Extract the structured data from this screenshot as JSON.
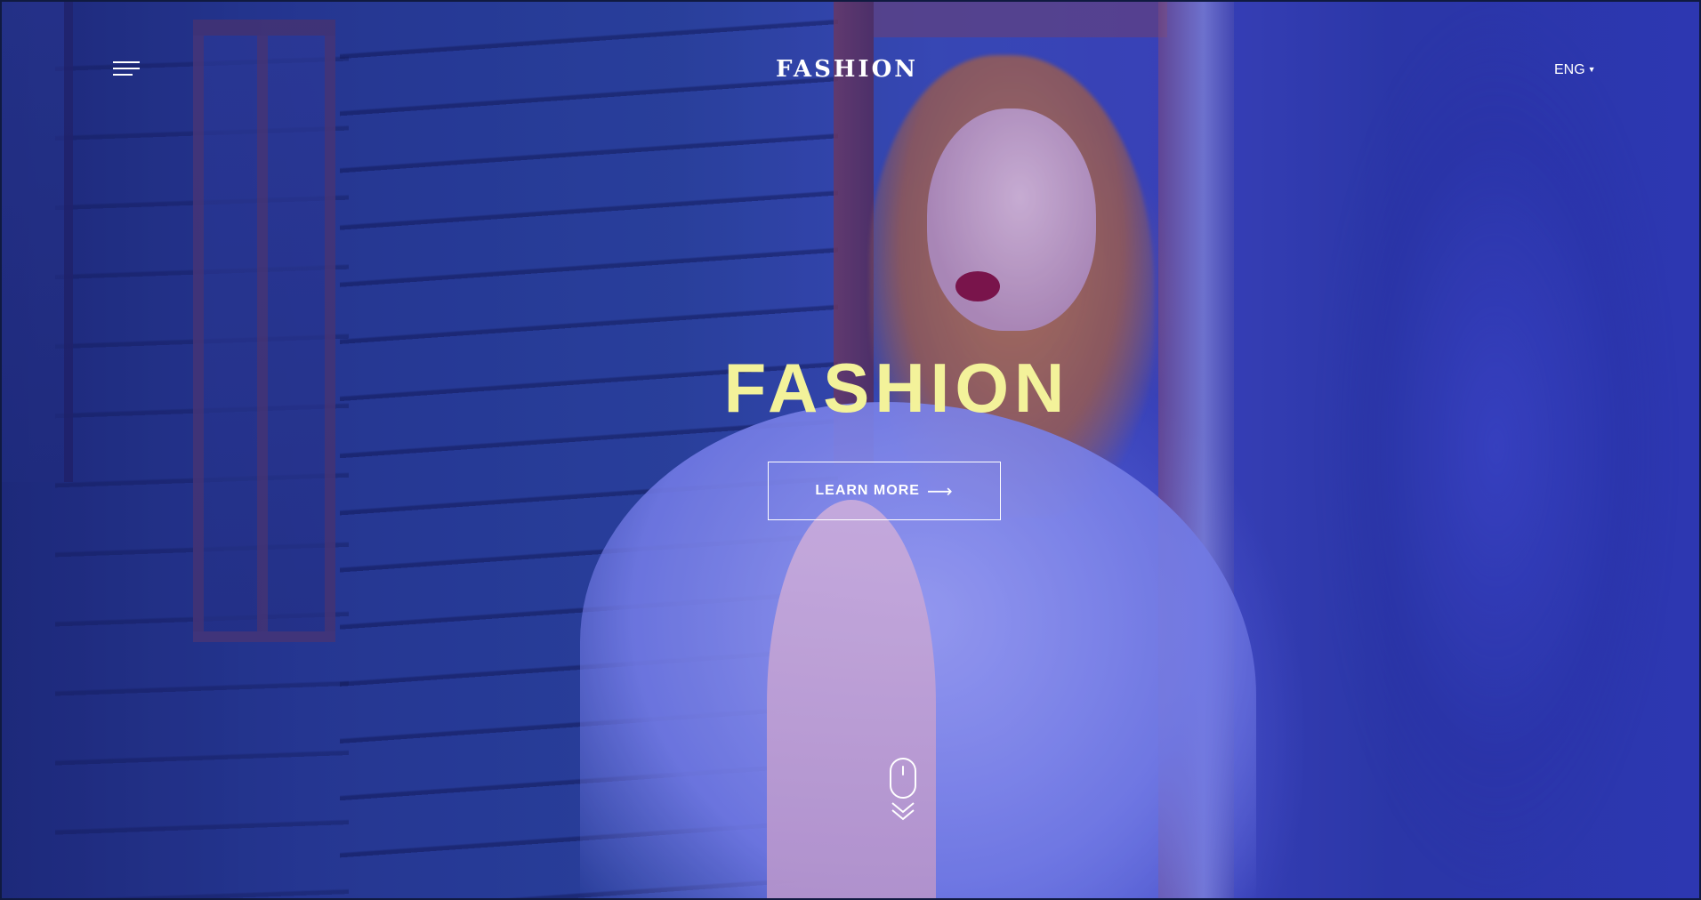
{
  "header": {
    "logo": "FASHION",
    "language": "ENG"
  },
  "hero": {
    "title": "FASHION",
    "cta_label": "LEARN MORE"
  },
  "icons": {
    "menu": "hamburger-menu-icon",
    "language_caret": "caret-down-icon",
    "cta_arrow": "long-right-arrow-icon",
    "scroll": "mouse-scroll-down-icon"
  },
  "colors": {
    "title": "#f3f29a",
    "text": "#ffffff",
    "overlay": "#3a3fc8"
  }
}
